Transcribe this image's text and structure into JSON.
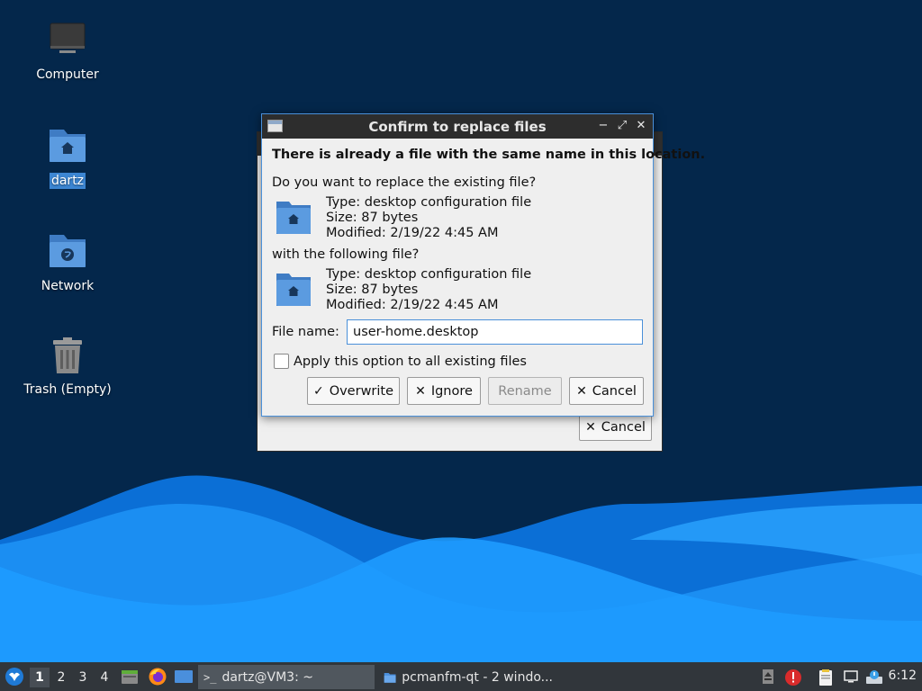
{
  "desktop": {
    "icons": [
      {
        "label": "Computer",
        "icon": "computer-icon"
      },
      {
        "label": "dartz",
        "icon": "home-folder-icon",
        "selected": true
      },
      {
        "label": "Network",
        "icon": "network-folder-icon"
      },
      {
        "label": "Trash (Empty)",
        "icon": "trash-icon"
      }
    ]
  },
  "background_dialog": {
    "cancel_label": "Cancel"
  },
  "dialog": {
    "title": "Confirm to replace files",
    "headline": "There is already a file with the same name in this location.",
    "question_existing": "Do you want to replace the existing file?",
    "existing_file": {
      "type": "Type: desktop configuration file",
      "size": "Size: 87 bytes",
      "modified": "Modified: 2/19/22 4:45 AM"
    },
    "question_new": "with the following file?",
    "new_file": {
      "type": "Type: desktop configuration file",
      "size": "Size: 87 bytes",
      "modified": "Modified: 2/19/22 4:45 AM"
    },
    "filename_label": "File name:",
    "filename_value": "user-home.desktop",
    "apply_all_label": "Apply this option to all existing files",
    "apply_all_checked": false,
    "buttons": {
      "overwrite": "Overwrite",
      "ignore": "Ignore",
      "rename": "Rename",
      "cancel": "Cancel"
    },
    "rename_enabled": false
  },
  "taskbar": {
    "desktops": [
      "1",
      "2",
      "3",
      "4"
    ],
    "active_desktop": "1",
    "tasks": [
      {
        "label": "dartz@VM3: ~",
        "icon": "terminal-icon",
        "active": true
      },
      {
        "label": "pcmanfm-qt - 2 windo...",
        "icon": "folder-icon",
        "active": false
      }
    ],
    "clock": "6:12"
  },
  "colors": {
    "desktop_bg": "#04274b",
    "wave_dark": "#0a6fd8",
    "wave_light": "#1e9bff",
    "accent": "#4a90d9",
    "taskbar": "#31363b"
  }
}
